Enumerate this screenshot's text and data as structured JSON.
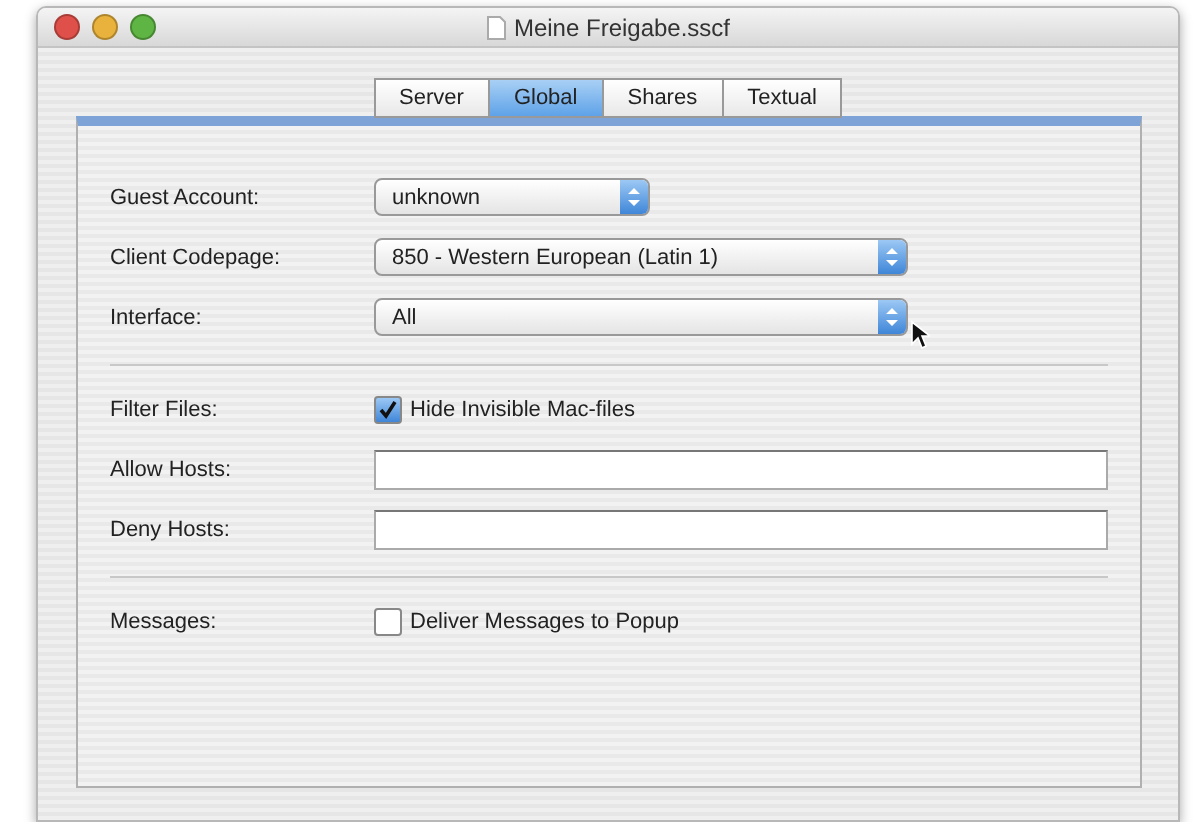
{
  "window": {
    "title": "Meine Freigabe.sscf"
  },
  "tabs": [
    {
      "label": "Server",
      "selected": false
    },
    {
      "label": "Global",
      "selected": true
    },
    {
      "label": "Shares",
      "selected": false
    },
    {
      "label": "Textual",
      "selected": false
    }
  ],
  "sections": [
    {
      "rows": [
        {
          "kind": "popup",
          "label": "Guest Account:",
          "value": "unknown",
          "wide": false
        },
        {
          "kind": "popup",
          "label": "Client Codepage:",
          "value": "850 - Western European (Latin 1)",
          "wide": true
        },
        {
          "kind": "popup",
          "label": "Interface:",
          "value": "All",
          "wide": true,
          "cursor": true
        }
      ]
    },
    {
      "rows": [
        {
          "kind": "checkbox",
          "label": "Filter Files:",
          "text": "Hide Invisible Mac-files",
          "checked": true
        },
        {
          "kind": "text",
          "label": "Allow Hosts:"
        },
        {
          "kind": "text",
          "label": "Deny Hosts:"
        }
      ]
    },
    {
      "rows": [
        {
          "kind": "checkbox",
          "label": "Messages:",
          "text": "Deliver Messages to Popup",
          "checked": false
        }
      ]
    }
  ]
}
